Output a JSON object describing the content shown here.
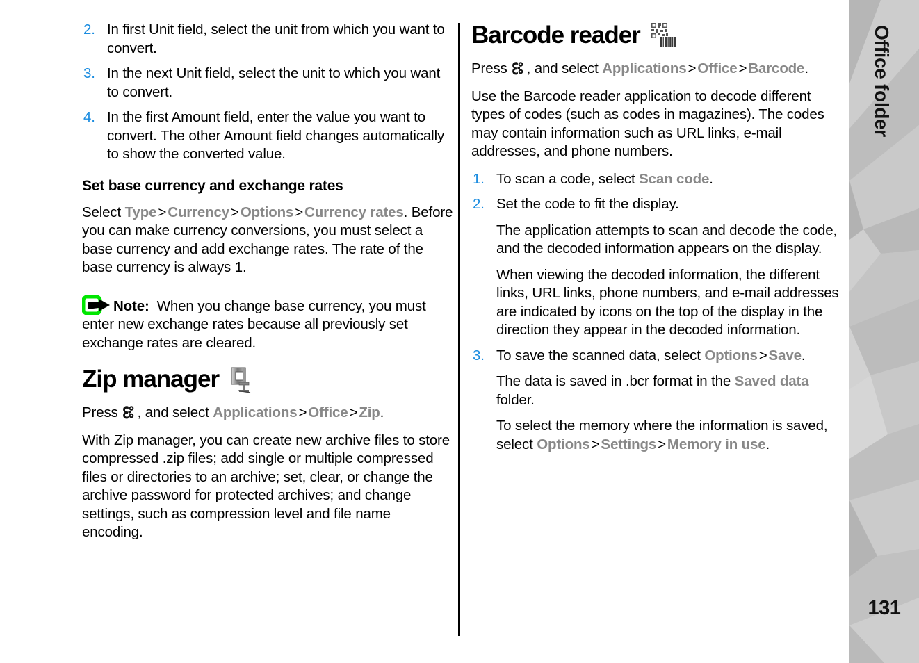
{
  "page": {
    "number": "131",
    "sidebar_title": "Office folder"
  },
  "left_column": {
    "steps_continued": [
      {
        "num": "2.",
        "text": "In first Unit field, select the unit from which you want to convert."
      },
      {
        "num": "3.",
        "text": "In the next Unit field, select the unit to which you want to convert."
      },
      {
        "num": "4.",
        "text": "In the first Amount field, enter the value you want to convert. The other Amount field changes automatically to show the converted value."
      }
    ],
    "subheading": "Set base currency and exchange rates",
    "currency_path": {
      "lead": "Select ",
      "items": [
        "Type",
        "Currency",
        "Options",
        "Currency rates"
      ],
      "separator": ">",
      "tail": ". Before you can make currency conversions, you must select a base currency and add exchange rates. The rate of the base currency is always 1."
    },
    "note": {
      "icon": "note-arrow-icon",
      "label": "Note:",
      "text": "When you change base currency, you must enter new exchange rates because all previously set exchange rates are cleared."
    },
    "zip": {
      "heading": "Zip manager",
      "icon": "clamp-icon",
      "press_lead": "Press",
      "press_key_icon": "menu-key-icon",
      "press_mid": ", and select ",
      "path_items": [
        "Applications",
        "Office",
        "Zip"
      ],
      "separator": ">",
      "path_tail": ".",
      "body": "With Zip manager, you can create new archive files to store compressed .zip files; add single or multiple compressed files or directories to an archive; set, clear, or change the archive password for protected archives; and change settings, such as compression level and file name encoding."
    }
  },
  "right_column": {
    "barcode": {
      "heading": "Barcode reader",
      "icon": "barcode-qr-icon",
      "press_lead": "Press",
      "press_key_icon": "menu-key-icon",
      "press_mid": ", and select ",
      "path_items": [
        "Applications",
        "Office",
        "Barcode"
      ],
      "separator": ">",
      "path_tail": ".",
      "intro": "Use the Barcode reader application to decode different types of codes (such as codes in magazines). The codes may contain information such as URL links, e-mail addresses, and phone numbers.",
      "steps": [
        {
          "num": "1.",
          "lead": "To scan a code, select ",
          "ui": "Scan code",
          "tail": ".",
          "subs": []
        },
        {
          "num": "2.",
          "lead": "Set the code to fit the display.",
          "ui": "",
          "tail": "",
          "subs": [
            "The application attempts to scan and decode the code, and the decoded information appears on the display.",
            "When viewing the decoded information, the different links, URL links, phone numbers, and e-mail addresses are indicated by icons on the top of the display in the direction they appear in the decoded information."
          ]
        },
        {
          "num": "3.",
          "lead": "To save the scanned data, select ",
          "ui": "Options",
          "ui2": "Save",
          "tail": ".",
          "subs": []
        }
      ],
      "saved_note": {
        "lead": "The data is saved in .bcr format in the ",
        "ui": "Saved data",
        "tail": " folder."
      },
      "memory_note": {
        "lead": "To select the memory where the information is saved, select ",
        "items": [
          "Options",
          "Settings",
          "Memory in use"
        ],
        "separator": ">",
        "tail": "."
      }
    }
  },
  "colors": {
    "list_number_blue": "#1a8ce0",
    "ui_reference_gray": "#888888",
    "note_icon_green": "#00e000",
    "sidebar_gray": "#c3c3c3",
    "text_black": "#000000"
  }
}
